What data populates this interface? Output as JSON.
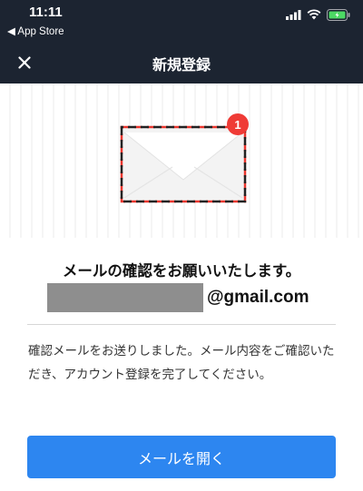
{
  "status_bar": {
    "time": "11:11",
    "back_label": "◀ App Store"
  },
  "nav": {
    "title": "新規登録",
    "close_icon": "close-icon"
  },
  "hero": {
    "badge_count": "1",
    "icon": "envelope-icon"
  },
  "main": {
    "heading": "メールの確認をお願いいたします。",
    "email_domain": "@gmail.com",
    "description": "確認メールをお送りしました。メール内容をご確認いただき、アカウント登録を完了してください。",
    "open_button": "メールを開く"
  },
  "colors": {
    "header_bg": "#1c2431",
    "button": "#2d86f0",
    "badge": "#ef3b36",
    "mask": "#8e8e8e"
  }
}
